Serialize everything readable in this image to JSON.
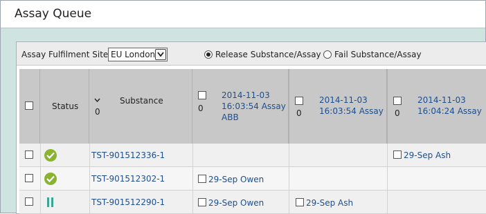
{
  "window": {
    "title": "Assay Queue"
  },
  "toolbar": {
    "site_label": "Assay Fulfilment Site",
    "site_value": "EU London",
    "release_label": "Release Substance/Assay",
    "fail_label": "Fail Substance/Assay",
    "release_selected": true
  },
  "table": {
    "status_header": "Status",
    "substance_header": "Substance",
    "substance_count": "0",
    "assays": [
      {
        "count": "0",
        "date": "2014-11-03",
        "time": "16:03:54 Assay",
        "extra": "ABB"
      },
      {
        "count": "0",
        "date": "2014-11-03",
        "time": "16:03:54 Assay",
        "extra": ""
      },
      {
        "count": "0",
        "date": "2014-11-03",
        "time": "16:04:24 Assay",
        "extra": ""
      }
    ],
    "rows": [
      {
        "status": "complete",
        "substance": "TST-901512336-1",
        "cells": [
          "",
          "",
          "29-Sep Ash"
        ]
      },
      {
        "status": "complete",
        "substance": "TST-901512302-1",
        "cells": [
          "29-Sep Owen",
          "",
          ""
        ]
      },
      {
        "status": "paused",
        "substance": "TST-901512290-1",
        "cells": [
          "29-Sep Owen",
          "29-Sep Ash",
          ""
        ]
      }
    ]
  },
  "icons": {
    "complete": "check-circle-icon",
    "paused": "pause-icon",
    "sort": "chevron-down-icon",
    "dropdown": "chevron-down-icon"
  },
  "colors": {
    "complete": "#8ab32f",
    "paused": "#3aa794",
    "link": "#1d4f8f",
    "header_bg": "#c8c8c8",
    "row_bg": "#f0f0f0",
    "frame_bg": "#cfe3e0"
  }
}
